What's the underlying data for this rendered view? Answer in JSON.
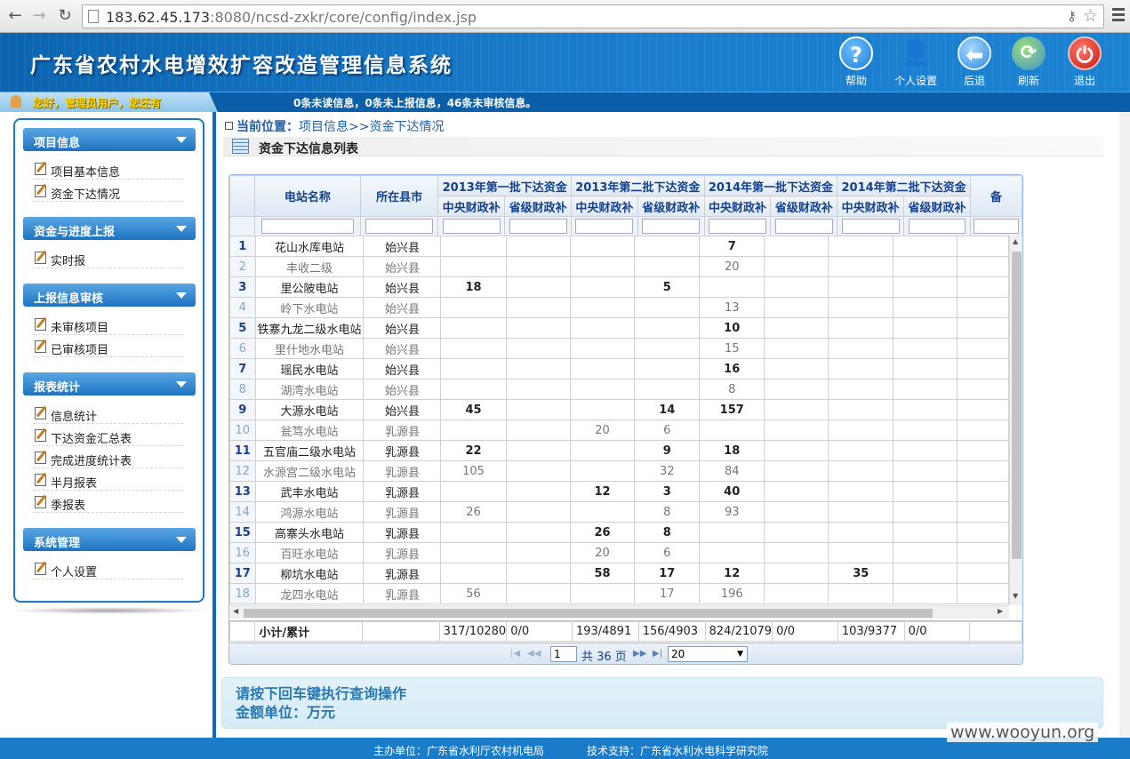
{
  "browser": {
    "url_host": "183.62.45.173",
    "url_rest": ":8080/ncsd-zxkr/core/config/index.jsp"
  },
  "header": {
    "title": "广东省农村水电增效扩容改造管理信息系统",
    "tools": [
      {
        "label": "帮助",
        "icon": "help-icon",
        "color": "#1e7fd6"
      },
      {
        "label": "个人设置",
        "icon": "person-icon",
        "color": "#3a3a3a"
      },
      {
        "label": "后退",
        "icon": "back-arrow-icon",
        "color": "#2f8be0"
      },
      {
        "label": "刷新",
        "icon": "refresh-icon",
        "color": "#4fae3a"
      },
      {
        "label": "退出",
        "icon": "power-icon",
        "color": "#d8271f"
      }
    ]
  },
  "status": {
    "greeting": "您好，管理员用户，您还有",
    "message": "0条未读信息，0条未上报信息，46条未审核信息。"
  },
  "sidebar": {
    "sections": [
      {
        "title": "项目信息",
        "items": [
          "项目基本信息",
          "资金下达情况"
        ]
      },
      {
        "title": "资金与进度上报",
        "items": [
          "实时报"
        ]
      },
      {
        "title": "上报信息审核",
        "items": [
          "未审核项目",
          "已审核项目"
        ]
      },
      {
        "title": "报表统计",
        "items": [
          "信息统计",
          "下达资金汇总表",
          "完成进度统计表",
          "半月报表",
          "季报表"
        ]
      },
      {
        "title": "系统管理",
        "items": [
          "个人设置"
        ]
      }
    ]
  },
  "breadcrumb": {
    "label": "当前位置：",
    "path": "项目信息>>资金下达情况"
  },
  "list_title": "资金下达信息列表",
  "grid": {
    "col_station": "电站名称",
    "col_county": "所在县市",
    "groups": [
      "2013年第一批下达资金",
      "2013年第二批下达资金",
      "2014年第一批下达资金",
      "2014年第二批下达资金"
    ],
    "sub_central": "中央财政补",
    "sub_province": "省级财政补",
    "col_more": "备",
    "rows": [
      [
        "1",
        "花山水库电站",
        "始兴县",
        "",
        "",
        "",
        "",
        "7",
        "",
        "",
        ""
      ],
      [
        "2",
        "丰收二级",
        "始兴县",
        "",
        "",
        "",
        "",
        "20",
        "",
        "",
        ""
      ],
      [
        "3",
        "里公陂电站",
        "始兴县",
        "18",
        "",
        "",
        "5",
        "",
        "",
        "",
        ""
      ],
      [
        "4",
        "岭下水电站",
        "始兴县",
        "",
        "",
        "",
        "",
        "13",
        "",
        "",
        ""
      ],
      [
        "5",
        "铁寨九龙二级水电站",
        "始兴县",
        "",
        "",
        "",
        "",
        "10",
        "",
        "",
        ""
      ],
      [
        "6",
        "里什地水电站",
        "始兴县",
        "",
        "",
        "",
        "",
        "15",
        "",
        "",
        ""
      ],
      [
        "7",
        "瑶民水电站",
        "始兴县",
        "",
        "",
        "",
        "",
        "16",
        "",
        "",
        ""
      ],
      [
        "8",
        "湖湾水电站",
        "始兴县",
        "",
        "",
        "",
        "",
        "8",
        "",
        "",
        ""
      ],
      [
        "9",
        "大源水电站",
        "始兴县",
        "45",
        "",
        "",
        "14",
        "157",
        "",
        "",
        ""
      ],
      [
        "10",
        "瓮笃水电站",
        "乳源县",
        "",
        "",
        "20",
        "6",
        "",
        "",
        "",
        ""
      ],
      [
        "11",
        "五官庙二级水电站",
        "乳源县",
        "22",
        "",
        "",
        "9",
        "18",
        "",
        "",
        ""
      ],
      [
        "12",
        "水源宫二级水电站",
        "乳源县",
        "105",
        "",
        "",
        "32",
        "84",
        "",
        "",
        ""
      ],
      [
        "13",
        "武丰水电站",
        "乳源县",
        "",
        "",
        "12",
        "3",
        "40",
        "",
        "",
        ""
      ],
      [
        "14",
        "鸿源水电站",
        "乳源县",
        "26",
        "",
        "",
        "8",
        "93",
        "",
        "",
        ""
      ],
      [
        "15",
        "高寨头水电站",
        "乳源县",
        "",
        "",
        "26",
        "8",
        "",
        "",
        "",
        ""
      ],
      [
        "16",
        "百旺水电站",
        "乳源县",
        "",
        "",
        "20",
        "6",
        "",
        "",
        "",
        ""
      ],
      [
        "17",
        "柳坑水电站",
        "乳源县",
        "",
        "",
        "58",
        "17",
        "12",
        "",
        "35",
        ""
      ],
      [
        "18",
        "龙四水电站",
        "乳源县",
        "56",
        "",
        "",
        "17",
        "196",
        "",
        "",
        ""
      ]
    ],
    "summary_label": "小计/累计",
    "summary": [
      "317/10280",
      "0/0",
      "193/4891",
      "156/4903",
      "824/21079",
      "0/0",
      "103/9377",
      "0/0"
    ]
  },
  "pager": {
    "page": "1",
    "pages_text": "共 36 页",
    "page_size": "20"
  },
  "note": {
    "line1": "请按下回车键执行查询操作",
    "line2": "金额单位：万元"
  },
  "footer": {
    "host": "主办单位：广东省水利厅农村机电局",
    "support": "技术支持：广东省水利水电科学研究院"
  },
  "watermark": "www.wooyun.org"
}
